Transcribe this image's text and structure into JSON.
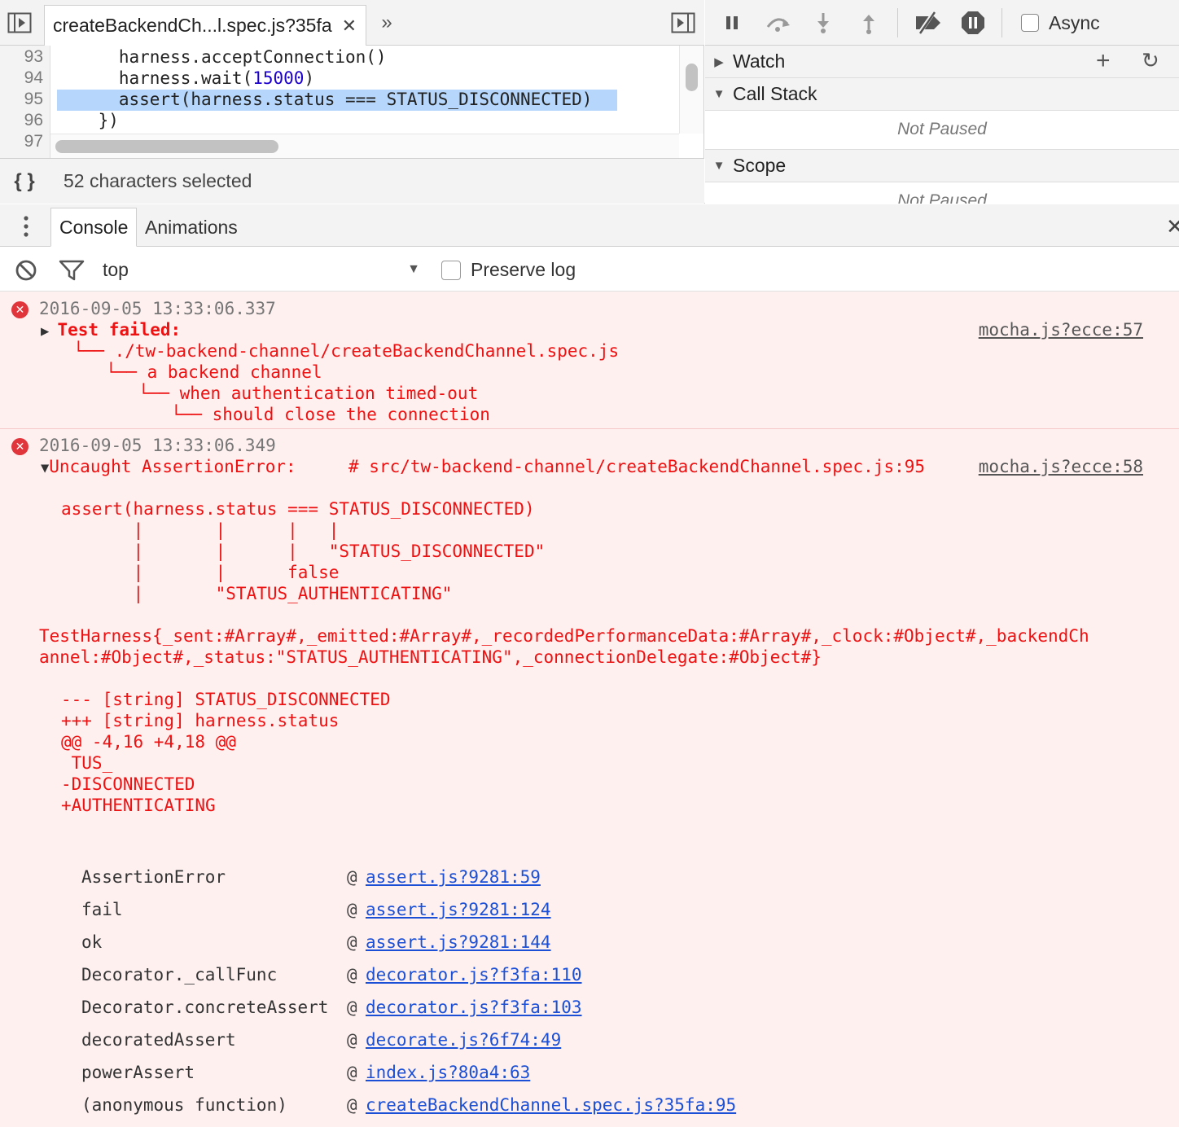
{
  "sources": {
    "file_tab": "createBackendCh...l.spec.js?35fa",
    "code_lines": [
      {
        "num": "93",
        "text": "      harness.acceptConnection()"
      },
      {
        "num": "94",
        "text": "      harness.wait(",
        "number": "15000",
        "after": ")"
      },
      {
        "num": "95",
        "text": "      assert(harness.status === STATUS_DISCONNECTED)"
      },
      {
        "num": "96",
        "text": "    })"
      },
      {
        "num": "97",
        "text": ""
      }
    ],
    "selection_status": "52 characters selected"
  },
  "debugger": {
    "async_label": "Async",
    "watch_label": "Watch",
    "call_stack_label": "Call Stack",
    "call_stack_status": "Not Paused",
    "scope_label": "Scope",
    "scope_status": "Not Paused"
  },
  "drawer": {
    "tabs": [
      "Console",
      "Animations"
    ]
  },
  "console_toolbar": {
    "context": "top",
    "preserve_log": "Preserve log"
  },
  "messages": [
    {
      "timestamp": "2016-09-05 13:33:06.337",
      "title": "Test failed:",
      "source": "mocha.js?ecce:57",
      "tree": [
        "└── ./tw-backend-channel/createBackendChannel.spec.js",
        "└── a backend channel",
        "└── when authentication timed-out",
        "└── should close the connection"
      ]
    },
    {
      "timestamp": "2016-09-05 13:33:06.349",
      "title": "Uncaught AssertionError:",
      "location": "# src/tw-backend-channel/createBackendChannel.spec.js:95",
      "source": "mocha.js?ecce:58",
      "power_assert": [
        "assert(harness.status === STATUS_DISCONNECTED)",
        "       |       |      |   |",
        "       |       |      |   \"STATUS_DISCONNECTED\"",
        "       |       |      false",
        "       |       \"STATUS_AUTHENTICATING\""
      ],
      "object_dump": [
        "TestHarness{_sent:#Array#,_emitted:#Array#,_recordedPerformanceData:#Array#,_clock:#Object#,_backendCh",
        "annel:#Object#,_status:\"STATUS_AUTHENTICATING\",_connectionDelegate:#Object#}"
      ],
      "diff": [
        "--- [string] STATUS_DISCONNECTED",
        "+++ [string] harness.status",
        "@@ -4,16 +4,18 @@",
        " TUS_",
        "-DISCONNECTED",
        "+AUTHENTICATING"
      ],
      "stack": [
        {
          "fn": "AssertionError",
          "link": "assert.js?9281:59"
        },
        {
          "fn": "fail",
          "link": "assert.js?9281:124"
        },
        {
          "fn": "ok",
          "link": "assert.js?9281:144"
        },
        {
          "fn": "Decorator._callFunc",
          "link": "decorator.js?f3fa:110"
        },
        {
          "fn": "Decorator.concreteAssert",
          "link": "decorator.js?f3fa:103"
        },
        {
          "fn": "decoratedAssert",
          "link": "decorate.js?6f74:49"
        },
        {
          "fn": "powerAssert",
          "link": "index.js?80a4:63"
        },
        {
          "fn": "(anonymous function)",
          "link": "createBackendChannel.spec.js?35fa:95"
        }
      ]
    }
  ],
  "colors": {
    "error_red": "#ee1111",
    "error_bg": "#fff0f0",
    "selection": "#b6d7fb",
    "link_blue": "#1a4fd6"
  }
}
